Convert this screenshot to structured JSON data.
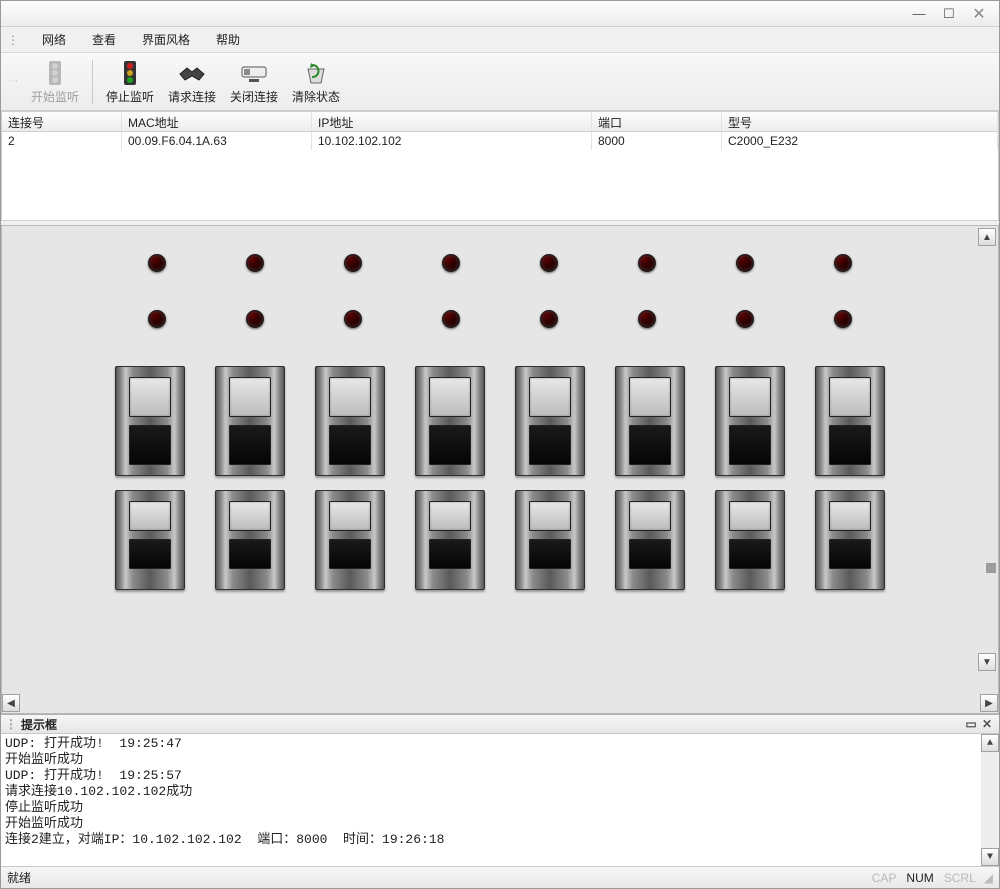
{
  "menu": {
    "items": [
      "网络",
      "查看",
      "界面风格",
      "帮助"
    ]
  },
  "toolbar": {
    "start_listen": "开始监听",
    "stop_listen": "停止监听",
    "request_conn": "请求连接",
    "close_conn": "关闭连接",
    "clear_status": "清除状态"
  },
  "table": {
    "headers": {
      "conn_id": "连接号",
      "mac": "MAC地址",
      "ip": "IP地址",
      "port": "端口",
      "model": "型号"
    },
    "rows": [
      {
        "conn_id": "2",
        "mac": "00.09.F6.04.1A.63",
        "ip": "10.102.102.102",
        "port": "8000",
        "model": "C2000_E232"
      }
    ]
  },
  "panel": {
    "led_rows": 2,
    "leds_per_row": 8,
    "switch_rows": 2,
    "switches_per_row": 8
  },
  "prompt": {
    "title": "提示框",
    "lines": [
      "UDP: 打开成功!  19:25:47",
      "开始监听成功",
      "UDP: 打开成功!  19:25:57",
      "请求连接10.102.102.102成功",
      "停止监听成功",
      "开始监听成功",
      "连接2建立，对端IP：10.102.102.102  端口：8000  时间：19:26:18"
    ]
  },
  "status": {
    "ready": "就绪",
    "cap": "CAP",
    "num": "NUM",
    "scrl": "SCRL"
  },
  "glyph": {
    "up": "▲",
    "down": "▼",
    "left": "◀",
    "right": "▶",
    "min": "—",
    "max": "☐",
    "close": "✕",
    "pin": "📌"
  }
}
